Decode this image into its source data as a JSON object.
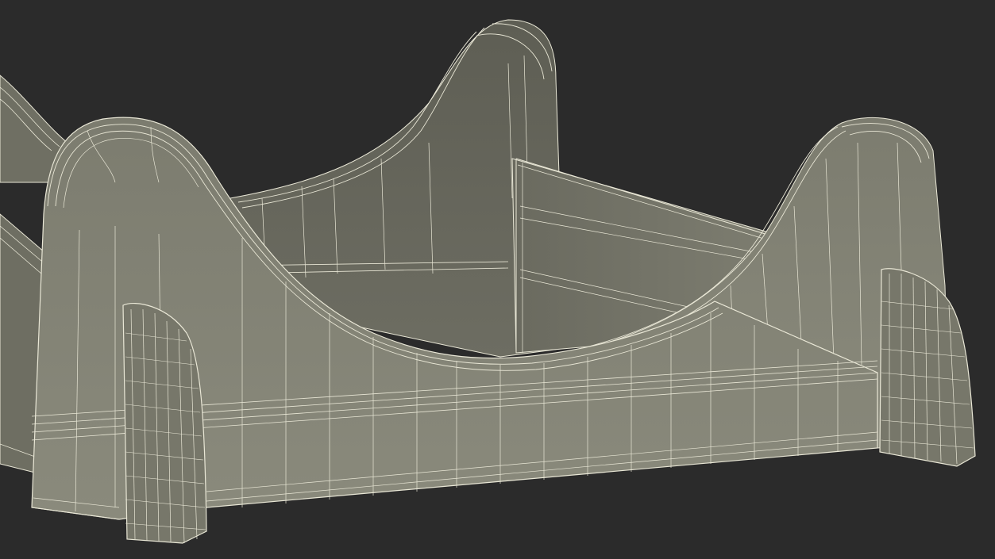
{
  "scene": {
    "background_color": "#2b2b2b",
    "surface_color": "#7d7d70",
    "surface_dark_color": "#5f5f55",
    "wire_color": "#e9e7d6",
    "render_mode": "wireframe-on-shaded",
    "subject": "stand"
  }
}
